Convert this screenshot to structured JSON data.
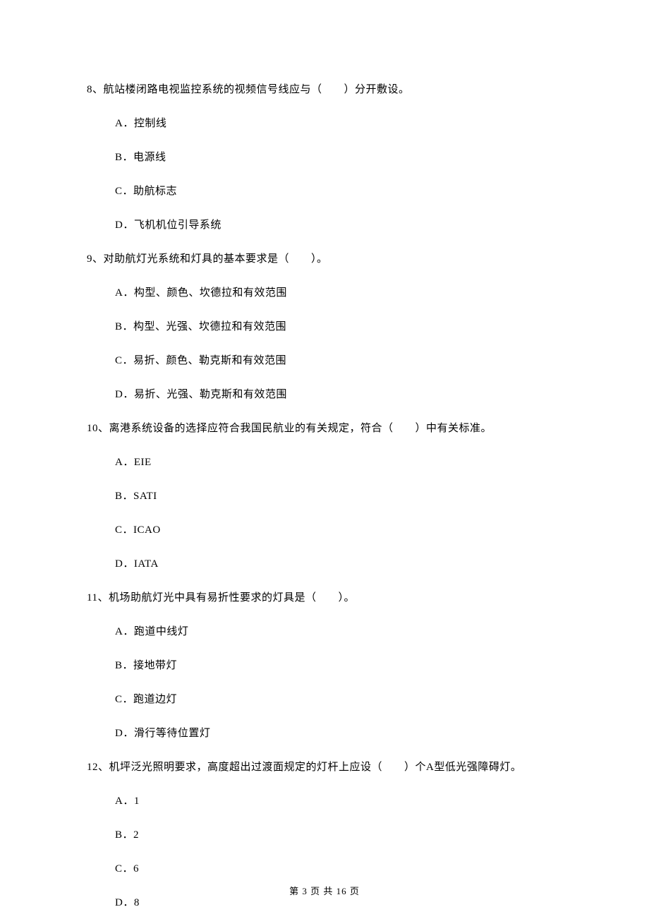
{
  "questions": [
    {
      "number": "8",
      "text": "8、航站楼闭路电视监控系统的视频信号线应与（　　）分开敷设。",
      "options": [
        "A．控制线",
        "B．电源线",
        "C．助航标志",
        "D．飞机机位引导系统"
      ]
    },
    {
      "number": "9",
      "text": "9、对助航灯光系统和灯具的基本要求是（　　）。",
      "options": [
        "A．构型、颜色、坎德拉和有效范围",
        "B．构型、光强、坎德拉和有效范围",
        "C．易折、颜色、勒克斯和有效范围",
        "D．易折、光强、勒克斯和有效范围"
      ]
    },
    {
      "number": "10",
      "text": "10、离港系统设备的选择应符合我国民航业的有关规定，符合（　　）中有关标准。",
      "options": [
        "A．EIE",
        "B．SATI",
        "C．ICAO",
        "D．IATA"
      ]
    },
    {
      "number": "11",
      "text": "11、机场助航灯光中具有易折性要求的灯具是（　　）。",
      "options": [
        "A．跑道中线灯",
        "B．接地带灯",
        "C．跑道边灯",
        "D．滑行等待位置灯"
      ]
    },
    {
      "number": "12",
      "text": "12、机坪泛光照明要求，高度超出过渡面规定的灯杆上应设（　　）个A型低光强障碍灯。",
      "options": [
        "A．1",
        "B．2",
        "C．6",
        "D．8"
      ]
    }
  ],
  "footer": "第 3 页 共 16 页"
}
